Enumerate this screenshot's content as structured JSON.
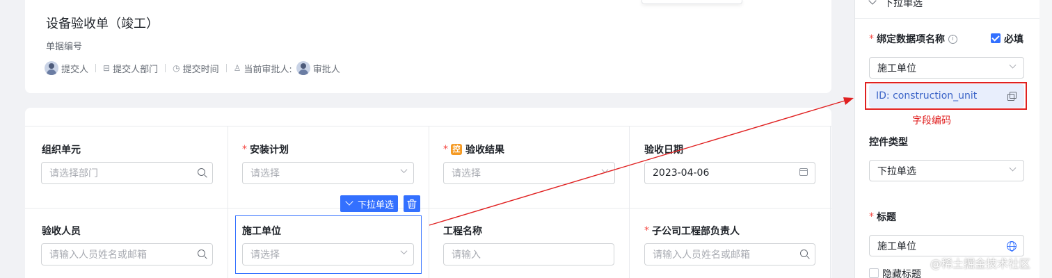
{
  "header": {
    "title": "设备验收单（竣工）",
    "doc_no": "单据编号",
    "meta": {
      "submitter": "提交人",
      "submitter_dept": "提交人部门",
      "submit_time": "提交时间",
      "current_approver_label": "当前审批人:",
      "approver": "审批人"
    }
  },
  "form": {
    "rows": [
      [
        {
          "label": "组织单元",
          "required": false,
          "placeholder": "请选择部门",
          "value": "",
          "icon": "search-icon"
        },
        {
          "label": "安装计划",
          "required": true,
          "placeholder": "请选择",
          "value": "",
          "icon": "chevron-down-icon"
        },
        {
          "label": "验收结果",
          "required": true,
          "badge": "控",
          "placeholder": "请选择",
          "value": "",
          "icon": "chevron-down-icon"
        },
        {
          "label": "验收日期",
          "required": false,
          "placeholder": "",
          "value": "2023-04-06",
          "icon": "calendar-icon"
        }
      ],
      [
        {
          "label": "验收人员",
          "required": false,
          "placeholder": "请输入人员姓名或邮箱",
          "value": "",
          "icon": "search-icon"
        },
        {
          "label": "施工单位",
          "required": false,
          "placeholder": "请选择",
          "value": "",
          "icon": "chevron-down-icon"
        },
        {
          "label": "工程名称",
          "required": false,
          "placeholder": "请输入",
          "value": "",
          "icon": ""
        },
        {
          "label": "子公司工程部负责人",
          "required": true,
          "placeholder": "请输入人员姓名或邮箱",
          "value": "",
          "icon": "search-icon"
        }
      ]
    ],
    "selected_toolbar": {
      "type_label": "下拉单选",
      "delete_icon": "trash-icon"
    }
  },
  "panel": {
    "section_title": "下拉单选",
    "bind_field_label": "绑定数据项名称",
    "required_checkbox": {
      "label": "必填",
      "checked": true
    },
    "bind_field_value": "施工单位",
    "field_id": "ID: construction_unit",
    "control_type_label": "控件类型",
    "control_type_value": "下拉单选",
    "title_label": "标题",
    "title_value": "施工单位",
    "hide_title_label": "隐藏标题"
  },
  "annotation": {
    "label": "字段编码",
    "color": "#e02020"
  },
  "watermark": "@稀土掘金技术社区",
  "colors": {
    "accent": "#3370ff",
    "required": "#f54a45",
    "badge": "#f59a23"
  }
}
